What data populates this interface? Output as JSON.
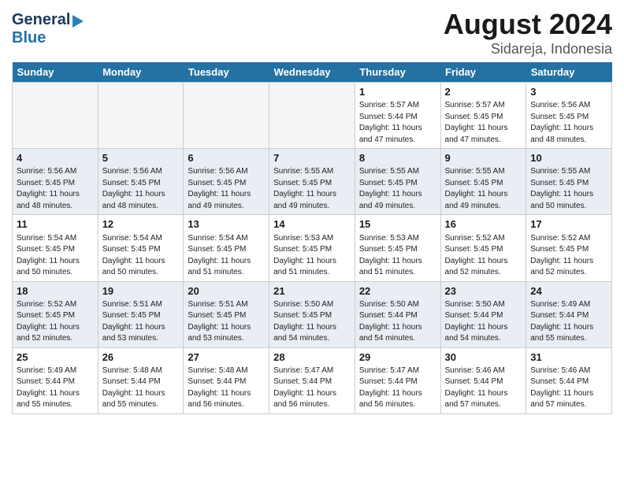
{
  "header": {
    "logo_line1": "General",
    "logo_line2": "Blue",
    "month_year": "August 2024",
    "location": "Sidareja, Indonesia"
  },
  "days_of_week": [
    "Sunday",
    "Monday",
    "Tuesday",
    "Wednesday",
    "Thursday",
    "Friday",
    "Saturday"
  ],
  "weeks": [
    [
      {
        "day": "",
        "empty": true
      },
      {
        "day": "",
        "empty": true
      },
      {
        "day": "",
        "empty": true
      },
      {
        "day": "",
        "empty": true
      },
      {
        "day": "1",
        "line1": "Sunrise: 5:57 AM",
        "line2": "Sunset: 5:44 PM",
        "line3": "Daylight: 11 hours",
        "line4": "and 47 minutes."
      },
      {
        "day": "2",
        "line1": "Sunrise: 5:57 AM",
        "line2": "Sunset: 5:45 PM",
        "line3": "Daylight: 11 hours",
        "line4": "and 47 minutes."
      },
      {
        "day": "3",
        "line1": "Sunrise: 5:56 AM",
        "line2": "Sunset: 5:45 PM",
        "line3": "Daylight: 11 hours",
        "line4": "and 48 minutes."
      }
    ],
    [
      {
        "day": "4",
        "line1": "Sunrise: 5:56 AM",
        "line2": "Sunset: 5:45 PM",
        "line3": "Daylight: 11 hours",
        "line4": "and 48 minutes."
      },
      {
        "day": "5",
        "line1": "Sunrise: 5:56 AM",
        "line2": "Sunset: 5:45 PM",
        "line3": "Daylight: 11 hours",
        "line4": "and 48 minutes."
      },
      {
        "day": "6",
        "line1": "Sunrise: 5:56 AM",
        "line2": "Sunset: 5:45 PM",
        "line3": "Daylight: 11 hours",
        "line4": "and 49 minutes."
      },
      {
        "day": "7",
        "line1": "Sunrise: 5:55 AM",
        "line2": "Sunset: 5:45 PM",
        "line3": "Daylight: 11 hours",
        "line4": "and 49 minutes."
      },
      {
        "day": "8",
        "line1": "Sunrise: 5:55 AM",
        "line2": "Sunset: 5:45 PM",
        "line3": "Daylight: 11 hours",
        "line4": "and 49 minutes."
      },
      {
        "day": "9",
        "line1": "Sunrise: 5:55 AM",
        "line2": "Sunset: 5:45 PM",
        "line3": "Daylight: 11 hours",
        "line4": "and 49 minutes."
      },
      {
        "day": "10",
        "line1": "Sunrise: 5:55 AM",
        "line2": "Sunset: 5:45 PM",
        "line3": "Daylight: 11 hours",
        "line4": "and 50 minutes."
      }
    ],
    [
      {
        "day": "11",
        "line1": "Sunrise: 5:54 AM",
        "line2": "Sunset: 5:45 PM",
        "line3": "Daylight: 11 hours",
        "line4": "and 50 minutes."
      },
      {
        "day": "12",
        "line1": "Sunrise: 5:54 AM",
        "line2": "Sunset: 5:45 PM",
        "line3": "Daylight: 11 hours",
        "line4": "and 50 minutes."
      },
      {
        "day": "13",
        "line1": "Sunrise: 5:54 AM",
        "line2": "Sunset: 5:45 PM",
        "line3": "Daylight: 11 hours",
        "line4": "and 51 minutes."
      },
      {
        "day": "14",
        "line1": "Sunrise: 5:53 AM",
        "line2": "Sunset: 5:45 PM",
        "line3": "Daylight: 11 hours",
        "line4": "and 51 minutes."
      },
      {
        "day": "15",
        "line1": "Sunrise: 5:53 AM",
        "line2": "Sunset: 5:45 PM",
        "line3": "Daylight: 11 hours",
        "line4": "and 51 minutes."
      },
      {
        "day": "16",
        "line1": "Sunrise: 5:52 AM",
        "line2": "Sunset: 5:45 PM",
        "line3": "Daylight: 11 hours",
        "line4": "and 52 minutes."
      },
      {
        "day": "17",
        "line1": "Sunrise: 5:52 AM",
        "line2": "Sunset: 5:45 PM",
        "line3": "Daylight: 11 hours",
        "line4": "and 52 minutes."
      }
    ],
    [
      {
        "day": "18",
        "line1": "Sunrise: 5:52 AM",
        "line2": "Sunset: 5:45 PM",
        "line3": "Daylight: 11 hours",
        "line4": "and 52 minutes."
      },
      {
        "day": "19",
        "line1": "Sunrise: 5:51 AM",
        "line2": "Sunset: 5:45 PM",
        "line3": "Daylight: 11 hours",
        "line4": "and 53 minutes."
      },
      {
        "day": "20",
        "line1": "Sunrise: 5:51 AM",
        "line2": "Sunset: 5:45 PM",
        "line3": "Daylight: 11 hours",
        "line4": "and 53 minutes."
      },
      {
        "day": "21",
        "line1": "Sunrise: 5:50 AM",
        "line2": "Sunset: 5:45 PM",
        "line3": "Daylight: 11 hours",
        "line4": "and 54 minutes."
      },
      {
        "day": "22",
        "line1": "Sunrise: 5:50 AM",
        "line2": "Sunset: 5:44 PM",
        "line3": "Daylight: 11 hours",
        "line4": "and 54 minutes."
      },
      {
        "day": "23",
        "line1": "Sunrise: 5:50 AM",
        "line2": "Sunset: 5:44 PM",
        "line3": "Daylight: 11 hours",
        "line4": "and 54 minutes."
      },
      {
        "day": "24",
        "line1": "Sunrise: 5:49 AM",
        "line2": "Sunset: 5:44 PM",
        "line3": "Daylight: 11 hours",
        "line4": "and 55 minutes."
      }
    ],
    [
      {
        "day": "25",
        "line1": "Sunrise: 5:49 AM",
        "line2": "Sunset: 5:44 PM",
        "line3": "Daylight: 11 hours",
        "line4": "and 55 minutes."
      },
      {
        "day": "26",
        "line1": "Sunrise: 5:48 AM",
        "line2": "Sunset: 5:44 PM",
        "line3": "Daylight: 11 hours",
        "line4": "and 55 minutes."
      },
      {
        "day": "27",
        "line1": "Sunrise: 5:48 AM",
        "line2": "Sunset: 5:44 PM",
        "line3": "Daylight: 11 hours",
        "line4": "and 56 minutes."
      },
      {
        "day": "28",
        "line1": "Sunrise: 5:47 AM",
        "line2": "Sunset: 5:44 PM",
        "line3": "Daylight: 11 hours",
        "line4": "and 56 minutes."
      },
      {
        "day": "29",
        "line1": "Sunrise: 5:47 AM",
        "line2": "Sunset: 5:44 PM",
        "line3": "Daylight: 11 hours",
        "line4": "and 56 minutes."
      },
      {
        "day": "30",
        "line1": "Sunrise: 5:46 AM",
        "line2": "Sunset: 5:44 PM",
        "line3": "Daylight: 11 hours",
        "line4": "and 57 minutes."
      },
      {
        "day": "31",
        "line1": "Sunrise: 5:46 AM",
        "line2": "Sunset: 5:44 PM",
        "line3": "Daylight: 11 hours",
        "line4": "and 57 minutes."
      }
    ]
  ]
}
